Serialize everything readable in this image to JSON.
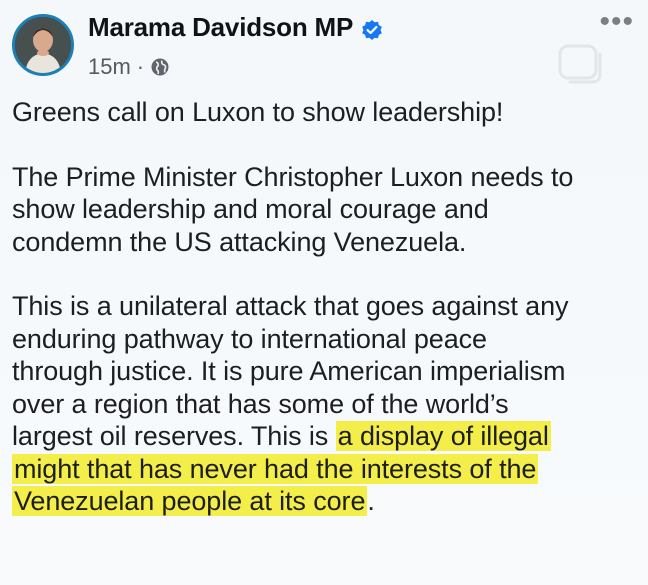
{
  "post": {
    "author": "Marama Davidson MP",
    "time": "15m",
    "separator": "·",
    "paragraphs": {
      "p1": "Greens call on Luxon to show leadership!",
      "p2_line1": "The Prime Minister Christopher Luxon needs to",
      "p2_line2": "show leadership and moral courage and",
      "p2_line3": "condemn the US attacking Venezuela.",
      "p3_line1": "This is a unilateral attack that goes against any",
      "p3_line2": "enduring pathway to international peace",
      "p3_line3": "through justice. It is pure American imperialism",
      "p3_line4": "over a region that has some of the world’s",
      "p3_line5_plain": "largest oil reserves. This is ",
      "p3_line5_highlight": "a display of illegal",
      "p3_line6_highlight": "might that has never had the interests of the",
      "p3_line7_highlight": "Venezuelan people at its core",
      "p3_line7_end": "."
    }
  },
  "icons": {
    "verified": "verified-badge-icon",
    "privacy": "globe-icon",
    "more": "more-options-icon"
  },
  "colors": {
    "verified": "#1877f2",
    "highlight": "#f4ee4a",
    "avatar_ring": "#1d7fb8"
  }
}
